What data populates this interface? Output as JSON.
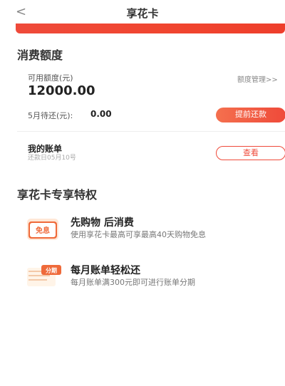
{
  "nav": {
    "back": "<",
    "title": "享花卡"
  },
  "credit": {
    "section_title": "消费额度",
    "available_label": "可用额度(元)",
    "manage_link": "额度管理>>",
    "available_amount": "12000.00",
    "due_label": "5月待还(元):",
    "due_amount": "0.00",
    "repay_button": "提前还款"
  },
  "bill": {
    "title": "我的账单",
    "repay_date": "还款日05月10号",
    "view_button": "查看"
  },
  "privileges": {
    "section_title": "享花卡专享特权",
    "items": [
      {
        "icon_text": "免息",
        "title": "先购物 后消费",
        "desc": "使用享花卡最高可享最高40天购物免息"
      },
      {
        "icon_text": "分期",
        "title": "每月账单轻松还",
        "desc": "每月账单满300元即可进行账单分期"
      }
    ]
  },
  "colors": {
    "accent": "#ef4a3a",
    "accent_light": "#f4704e"
  }
}
